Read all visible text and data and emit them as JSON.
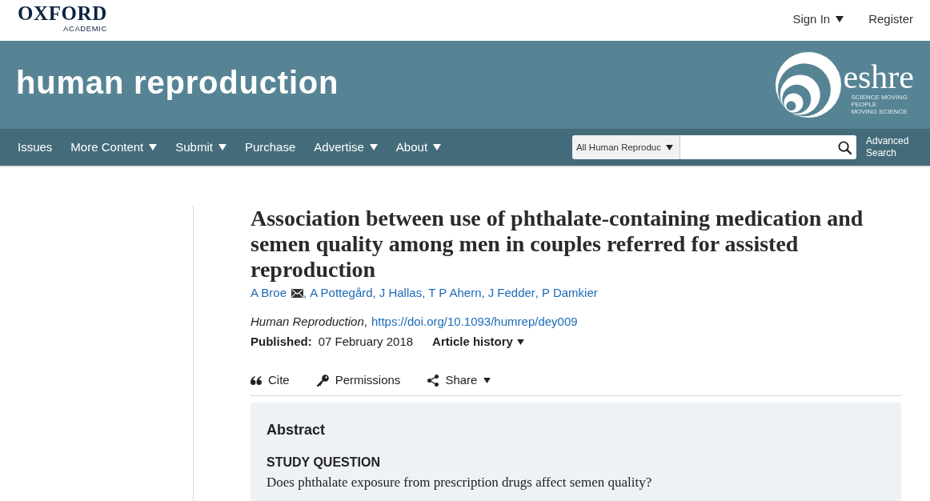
{
  "header": {
    "logo": {
      "name": "OXFORD",
      "subtitle": "ACADEMIC"
    },
    "account_links": [
      {
        "label": "Sign In",
        "dropdown": true
      },
      {
        "label": "Register",
        "dropdown": false
      }
    ]
  },
  "banner": {
    "journal_title": "human reproduction",
    "society_logo": {
      "wordmark": "eshre",
      "tagline": [
        "SCIENCE MOVING",
        "PEOPLE",
        "MOVING SCIENCE"
      ]
    }
  },
  "nav": {
    "items": [
      {
        "label": "Issues",
        "dropdown": false
      },
      {
        "label": "More Content",
        "dropdown": true
      },
      {
        "label": "Submit",
        "dropdown": true
      },
      {
        "label": "Purchase",
        "dropdown": false
      },
      {
        "label": "Advertise",
        "dropdown": true
      },
      {
        "label": "About",
        "dropdown": true
      }
    ],
    "search": {
      "scope": "All Human Reproduc",
      "advanced_link": "Advanced Search"
    }
  },
  "article": {
    "title": "Association between use of phthalate-containing medication and semen quality among men in couples referred for assisted reproduction",
    "authors": [
      {
        "name": "A Broe",
        "corresponding": true,
        "separator": ","
      },
      {
        "name": "A Pottegård",
        "corresponding": false,
        "separator": ","
      },
      {
        "name": "J Hallas",
        "corresponding": false,
        "separator": ","
      },
      {
        "name": "T P Ahern",
        "corresponding": false,
        "separator": ","
      },
      {
        "name": "J Fedder",
        "corresponding": false,
        "separator": ","
      },
      {
        "name": "P Damkier",
        "corresponding": false
      }
    ],
    "citation": {
      "journal": "*Human Reproduction*,",
      "doi": "https://doi.org/10.1093/humrep/dey009"
    },
    "published": {
      "label": "Published:",
      "date": "07 February 2018"
    },
    "history": {
      "label": "Article history",
      "dropdown": true
    },
    "tools": [
      {
        "kind": "cite",
        "label": "Cite",
        "dropdown": false
      },
      {
        "kind": "permissions",
        "label": "Permissions",
        "dropdown": false
      },
      {
        "kind": "share",
        "label": "Share",
        "dropdown": true
      }
    ],
    "abstract": {
      "heading": "Abstract",
      "sections": [
        {
          "heading": "STUDY QUESTION",
          "text": "Does phthalate exposure from prescription drugs affect semen quality?"
        }
      ]
    }
  }
}
